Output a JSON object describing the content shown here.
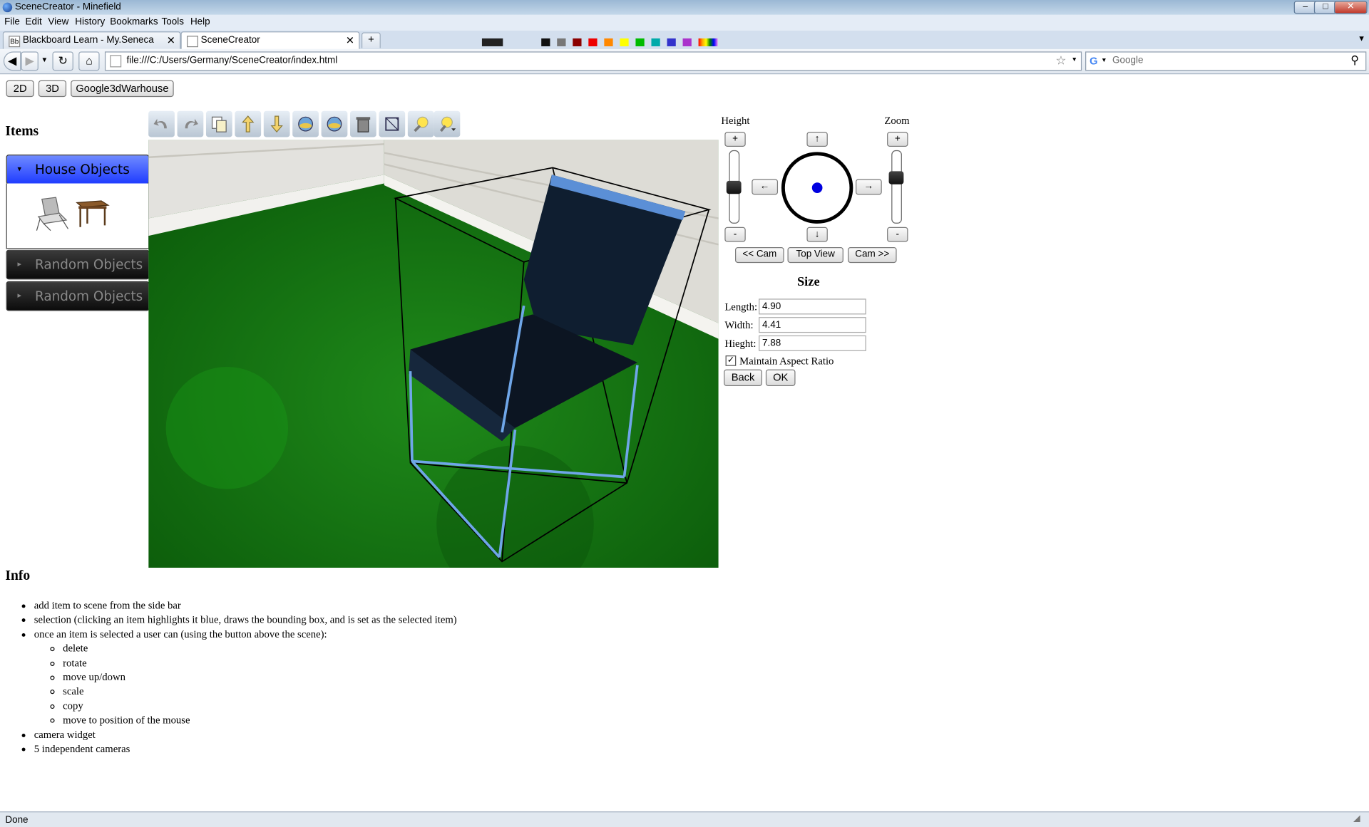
{
  "window": {
    "title": "SceneCreator - Minefield"
  },
  "menu": [
    "File",
    "Edit",
    "View",
    "History",
    "Bookmarks",
    "Tools",
    "Help"
  ],
  "tabs": [
    {
      "label": "Blackboard Learn - My.Seneca"
    },
    {
      "label": "SceneCreator"
    }
  ],
  "nav": {
    "url": "file:///C:/Users/Germany/SceneCreator/index.html",
    "search_placeholder": "Google"
  },
  "view_buttons": [
    "2D",
    "3D",
    "Google3dWarhouse"
  ],
  "items": {
    "heading": "Items",
    "groups": [
      {
        "label": "House Objects",
        "open": true
      },
      {
        "label": "Random Objects",
        "open": false
      },
      {
        "label": "Random Objects",
        "open": false
      }
    ],
    "thumbnails": [
      "chair-thumbnail",
      "table-thumbnail"
    ]
  },
  "toolbar_icons": [
    "undo-icon",
    "redo-icon",
    "copy-icon",
    "move-up-icon",
    "move-down-icon",
    "rotate-left-icon",
    "rotate-right-icon",
    "delete-icon",
    "scale-icon",
    "light-icon",
    "light-dropdown-icon"
  ],
  "camera": {
    "height_label": "Height",
    "zoom_label": "Zoom",
    "plus": "+",
    "minus": "-",
    "up": "↑",
    "down": "↓",
    "left": "←",
    "right": "→",
    "prev_cam": "<< Cam",
    "top_view": "Top View",
    "next_cam": "Cam >>",
    "height_level": 0.5,
    "zoom_level": 0.35
  },
  "size": {
    "heading": "Size",
    "length_label": "Length:",
    "length": "4.90",
    "width_label": "Width:",
    "width": "4.41",
    "height_label": "Hieght:",
    "height": "7.88",
    "aspect_label": "Maintain Aspect Ratio",
    "aspect_checked": true,
    "back": "Back",
    "ok": "OK"
  },
  "info": {
    "heading": "Info",
    "items": [
      "add item to scene from the side bar",
      "selection (clicking an item highlights it blue, draws the bounding box, and is set as the selected item)",
      "once an item is selected a user can (using the button above the scene):"
    ],
    "sub_items": [
      "delete",
      "rotate",
      "move up/down",
      "scale",
      "copy",
      "move to position of the mouse"
    ],
    "items_after": [
      "camera widget",
      "5 independent cameras"
    ]
  },
  "status": {
    "text": "Done"
  }
}
